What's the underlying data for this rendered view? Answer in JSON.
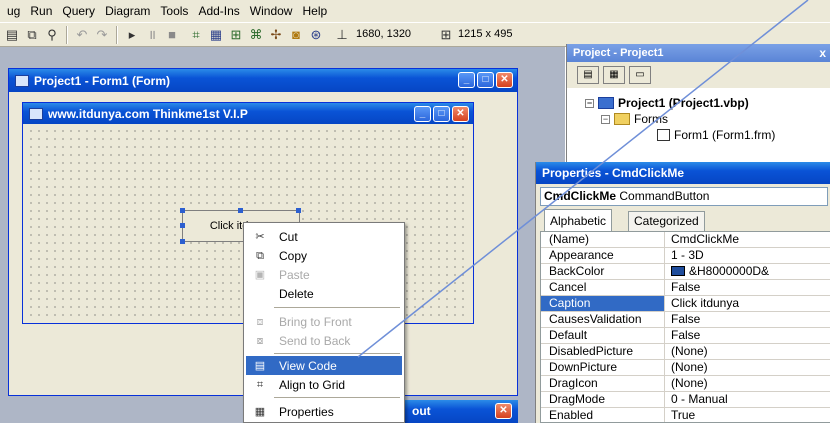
{
  "menu": [
    "ug",
    "Run",
    "Query",
    "Diagram",
    "Tools",
    "Add-Ins",
    "Window",
    "Help"
  ],
  "toolbar": {
    "position": "1680, 1320",
    "size": "1215 x 495"
  },
  "project_window": {
    "title": "Project1 - Form1 (Form)"
  },
  "form_window": {
    "title": "www.itdunya.com  Thinkme1st V.I.P"
  },
  "command_button": {
    "caption": "Click itdunya"
  },
  "lower_window": {
    "title": "out"
  },
  "context_menu": {
    "items": [
      {
        "label": "Cut",
        "icon": "scissors-icon",
        "enabled": true
      },
      {
        "label": "Copy",
        "icon": "copy-icon",
        "enabled": true
      },
      {
        "label": "Paste",
        "icon": "paste-icon",
        "enabled": false
      },
      {
        "label": "Delete",
        "icon": "",
        "enabled": true
      },
      {
        "label": "Bring to Front",
        "icon": "bring-front-icon",
        "enabled": false
      },
      {
        "label": "Send to Back",
        "icon": "send-back-icon",
        "enabled": false
      },
      {
        "label": "View Code",
        "icon": "view-code-icon",
        "enabled": true,
        "selected": true
      },
      {
        "label": "Align to Grid",
        "icon": "align-grid-icon",
        "enabled": true
      },
      {
        "label": "Properties",
        "icon": "properties-icon",
        "enabled": true
      }
    ]
  },
  "project_panel": {
    "title": "Project - Project1",
    "close": "x",
    "tree": [
      {
        "label": "Project1 (Project1.vbp)",
        "bold": true
      },
      {
        "label": "Forms"
      },
      {
        "label": "Form1 (Form1.frm)"
      }
    ]
  },
  "properties_panel": {
    "title": "Properties - CmdClickMe",
    "object_name": "CmdClickMe",
    "object_type": "CommandButton",
    "tabs": [
      "Alphabetic",
      "Categorized"
    ],
    "active_tab": "Alphabetic",
    "selected_property": "Caption",
    "rows": [
      {
        "name": "(Name)",
        "value": "CmdClickMe"
      },
      {
        "name": "Appearance",
        "value": "1 - 3D"
      },
      {
        "name": "BackColor",
        "value": "&H8000000D&"
      },
      {
        "name": "Cancel",
        "value": "False"
      },
      {
        "name": "Caption",
        "value": "Click itdunya"
      },
      {
        "name": "CausesValidation",
        "value": "False"
      },
      {
        "name": "Default",
        "value": "False"
      },
      {
        "name": "DisabledPicture",
        "value": "(None)"
      },
      {
        "name": "DownPicture",
        "value": "(None)"
      },
      {
        "name": "DragIcon",
        "value": "(None)"
      },
      {
        "name": "DragMode",
        "value": "0 - Manual"
      },
      {
        "name": "Enabled",
        "value": "True"
      }
    ]
  },
  "colors": {
    "titlebar": "#0a53d6",
    "selection": "#316ac5",
    "annotation_line": "#6f8fd8",
    "backcolor_swatch": "#1f4d9c"
  }
}
